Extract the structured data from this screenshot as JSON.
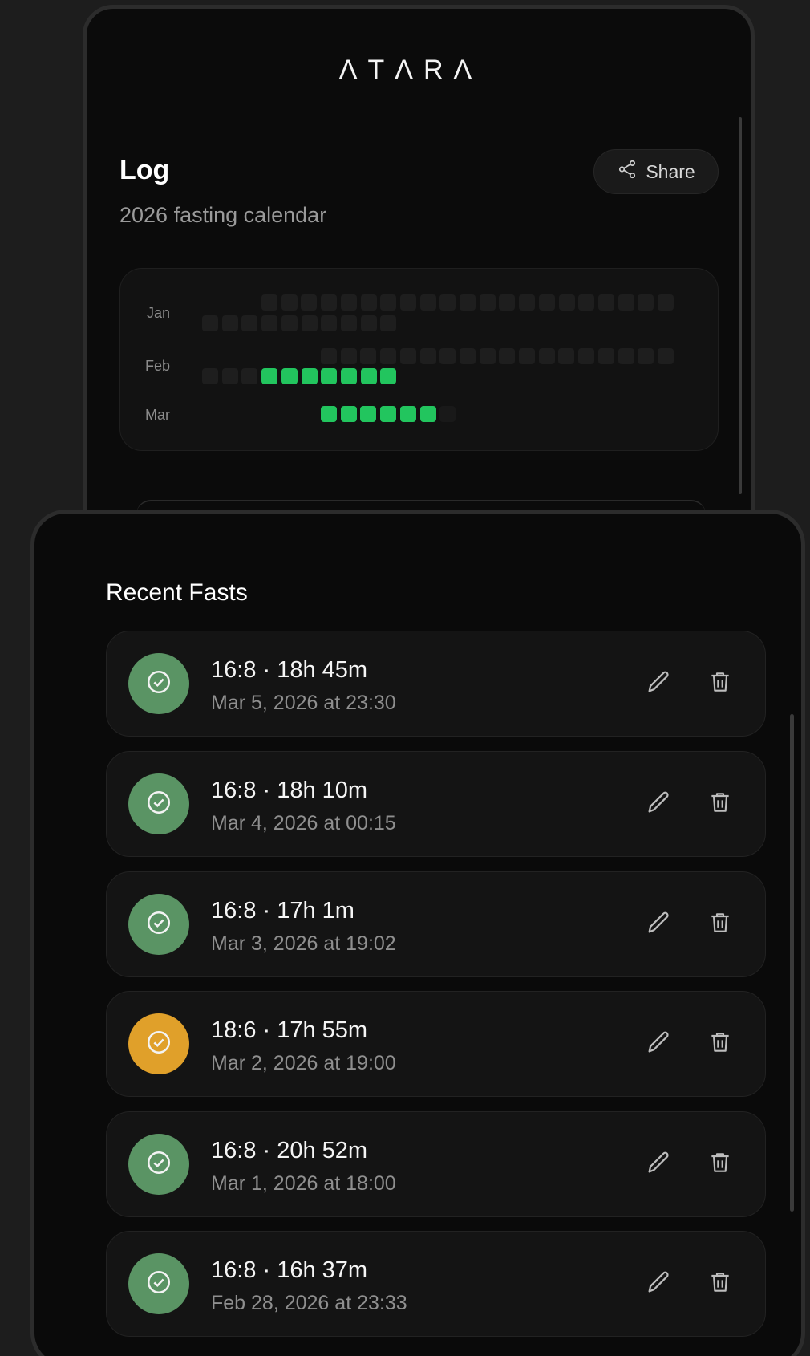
{
  "app": {
    "logo": "ΛTΛRΛ"
  },
  "log": {
    "title": "Log",
    "subtitle": "2026 fasting calendar",
    "share_label": "Share"
  },
  "calendar": {
    "months": [
      "Jan",
      "Feb",
      "Mar"
    ],
    "fasted_days": {
      "Feb": [
        22,
        23,
        24,
        25,
        26,
        27,
        28
      ],
      "Mar": [
        1,
        2,
        3,
        4,
        5,
        6
      ]
    }
  },
  "recent": {
    "title": "Recent Fasts",
    "items": [
      {
        "main": "16:8 · 18h 45m",
        "date": "Mar 5, 2026 at 23:30",
        "status": "complete"
      },
      {
        "main": "16:8 · 18h 10m",
        "date": "Mar 4, 2026 at 00:15",
        "status": "complete"
      },
      {
        "main": "16:8 · 17h 1m",
        "date": "Mar 3, 2026 at 19:02",
        "status": "complete"
      },
      {
        "main": "18:6 · 17h 55m",
        "date": "Mar 2, 2026 at 19:00",
        "status": "short"
      },
      {
        "main": "16:8 · 20h 52m",
        "date": "Mar 1, 2026 at 18:00",
        "status": "complete"
      },
      {
        "main": "16:8 · 16h 37m",
        "date": "Feb 28, 2026 at 23:33",
        "status": "complete"
      }
    ]
  },
  "colors": {
    "complete": "#5a9464",
    "short": "#e0a02a",
    "calendar_on": "#22c55e"
  },
  "icons": {
    "share": "share-icon",
    "status": "check-circle-icon",
    "edit": "pencil-icon",
    "delete": "trash-icon"
  }
}
